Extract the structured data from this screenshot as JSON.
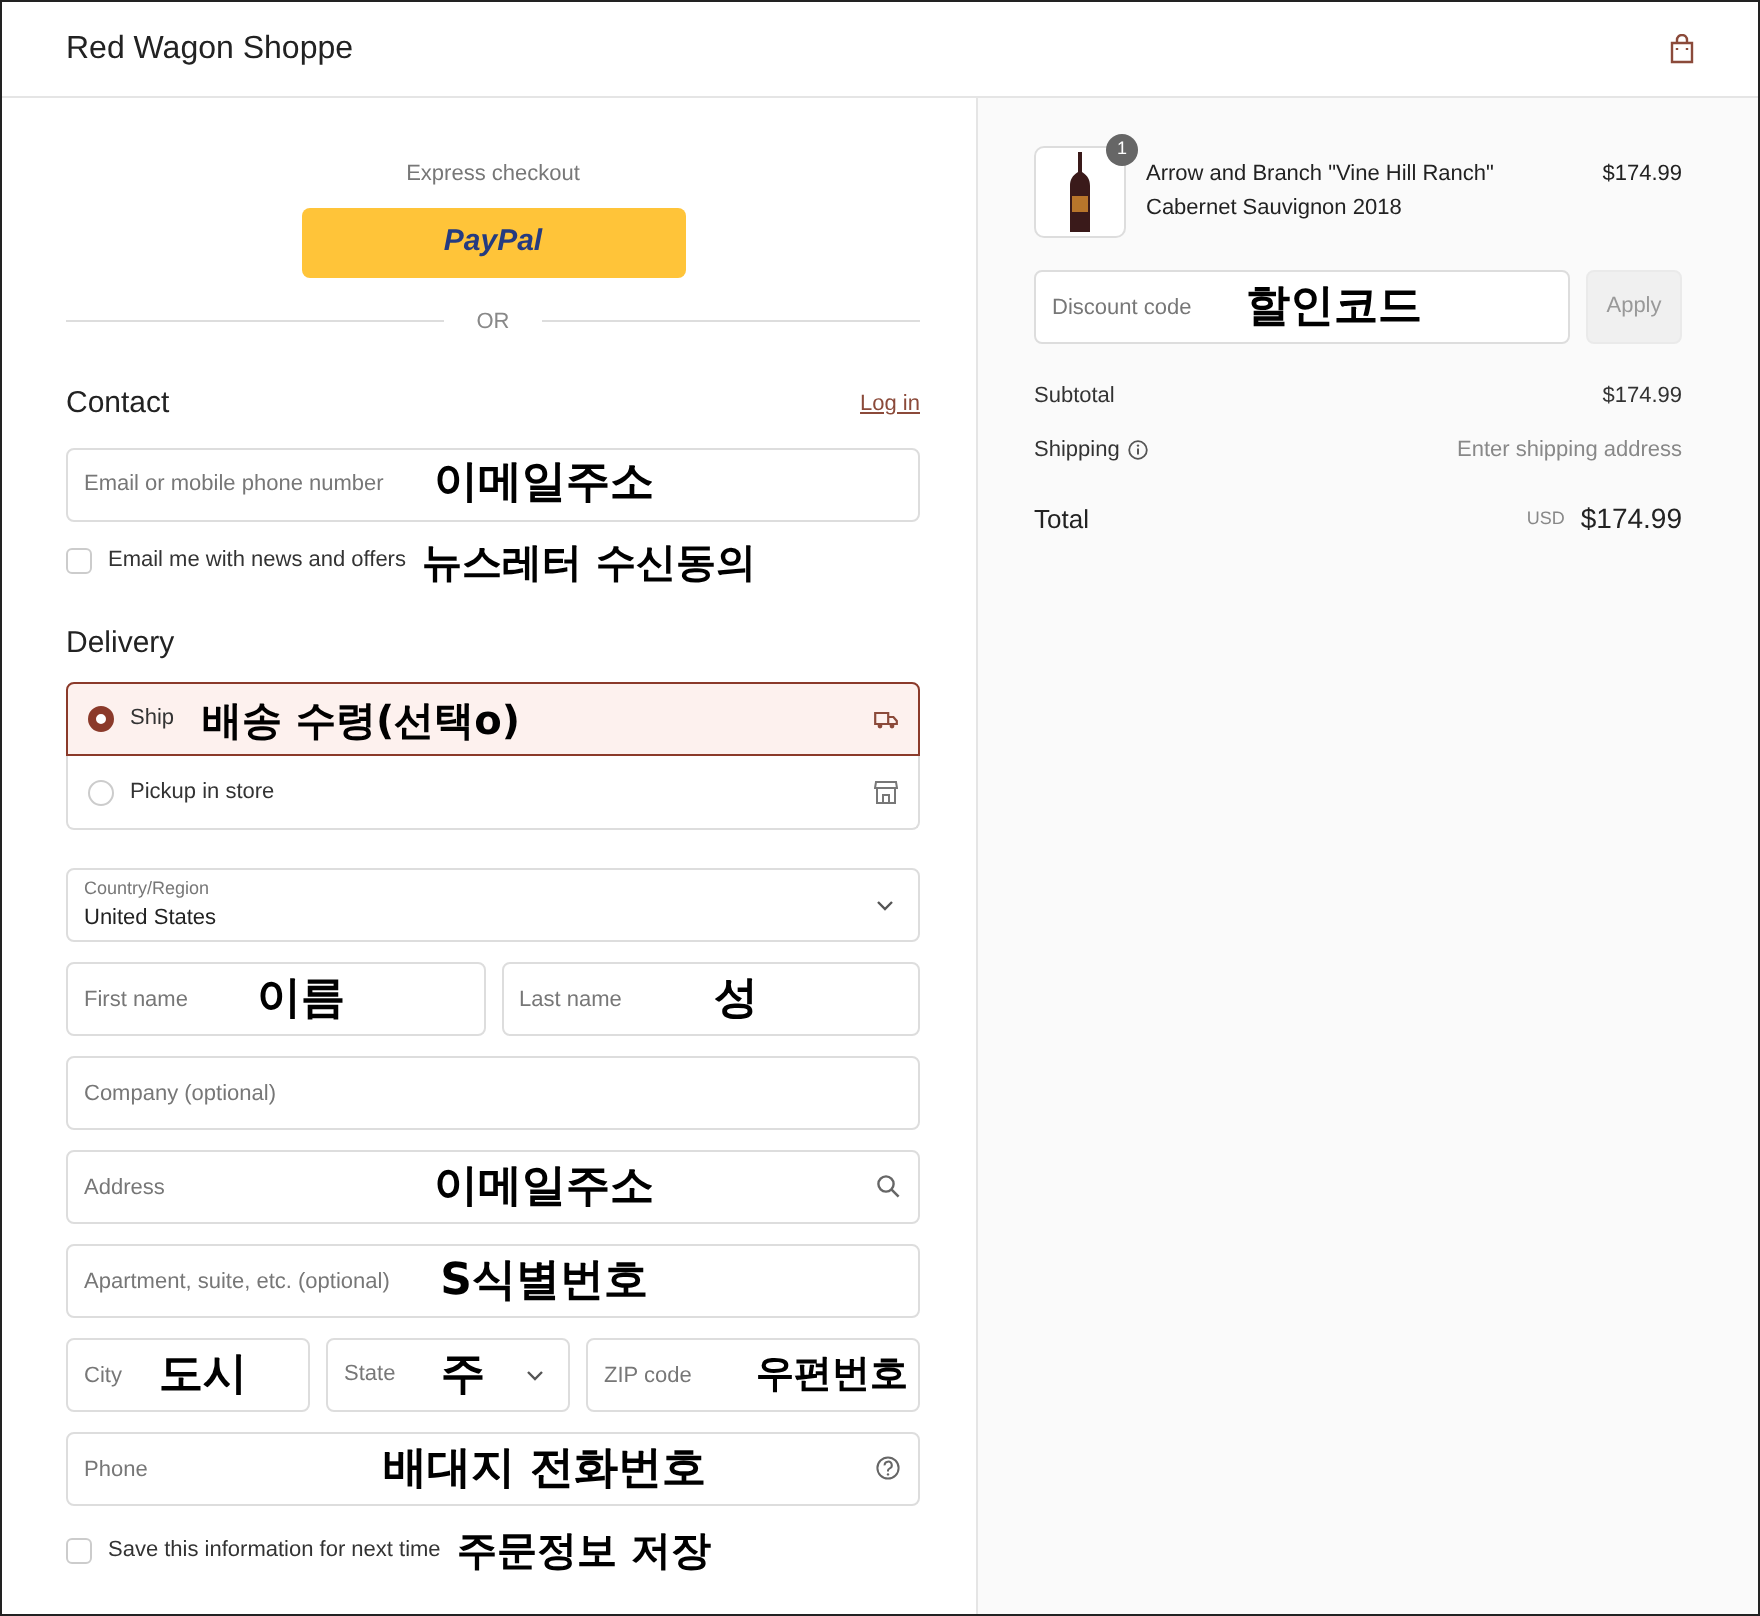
{
  "header": {
    "store_name": "Red Wagon Shoppe"
  },
  "express": {
    "label": "Express checkout",
    "button": "PayPal",
    "divider": "OR"
  },
  "contact": {
    "heading": "Contact",
    "login_link": "Log in",
    "email": {
      "placeholder": "Email or mobile phone number",
      "annotation": "이메일주소"
    },
    "newsletter": {
      "label": "Email me with news and offers",
      "checked": false,
      "annotation": "뉴스레터 수신동의"
    }
  },
  "delivery": {
    "heading": "Delivery",
    "options": [
      {
        "label": "Ship",
        "selected": true,
        "kind": "truck",
        "annotation": "배송 수령(선택o)"
      },
      {
        "label": "Pickup in store",
        "selected": false,
        "kind": "store"
      }
    ],
    "country": {
      "label": "Country/Region",
      "value": "United States"
    },
    "first_name": {
      "placeholder": "First name",
      "annotation": "이름"
    },
    "last_name": {
      "placeholder": "Last name",
      "annotation": "성"
    },
    "company": {
      "placeholder": "Company (optional)"
    },
    "address": {
      "kind": "search",
      "placeholder": "Address",
      "annotation": "이메일주소"
    },
    "apartment": {
      "placeholder": "Apartment, suite, etc. (optional)",
      "annotation": "S식별번호"
    },
    "city": {
      "placeholder": "City",
      "annotation": "도시"
    },
    "state": {
      "kind": "select",
      "placeholder": "State",
      "annotation": "주"
    },
    "zip": {
      "placeholder": "ZIP code",
      "annotation": "우편번호"
    },
    "phone": {
      "kind": "help",
      "placeholder": "Phone",
      "annotation": "배대지 전화번호"
    },
    "save": {
      "label": "Save this information for next time",
      "checked": false,
      "annotation": "주문정보 저장"
    }
  },
  "summary": {
    "item": {
      "quantity": "1",
      "name": "Arrow and Branch \"Vine Hill Ranch\" Cabernet Sauvignon 2018",
      "price": "$174.99"
    },
    "discount": {
      "placeholder": "Discount code",
      "annotation": "할인코드",
      "button": "Apply"
    },
    "subtotal": {
      "label": "Subtotal",
      "value": "$174.99"
    },
    "shipping": {
      "label": "Shipping",
      "value": "Enter shipping address"
    },
    "total": {
      "label": "Total",
      "currency": "USD",
      "value": "$174.99"
    }
  }
}
